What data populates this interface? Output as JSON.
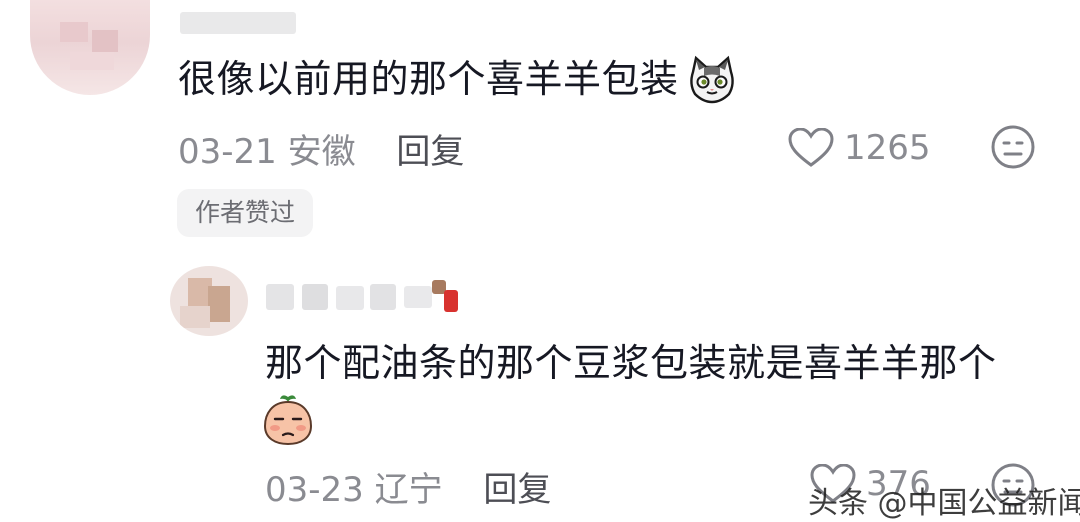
{
  "comments": [
    {
      "text": "很像以前用的那个喜羊羊包装",
      "date": "03-21",
      "location": "安徽",
      "reply_label": "回复",
      "likes": "1265",
      "badge": "作者赞过",
      "emoji": "cat-emoji"
    },
    {
      "text": "那个配油条的那个豆浆包装就是喜羊羊那个",
      "date": "03-23",
      "location": "辽宁",
      "reply_label": "回复",
      "likes": "376",
      "emoji": "peach-emoji"
    }
  ],
  "watermark": "头条 @中国公益新闻",
  "colors": {
    "text": "#161823",
    "meta": "#8a8b91",
    "badge_bg": "#f3f3f4"
  }
}
